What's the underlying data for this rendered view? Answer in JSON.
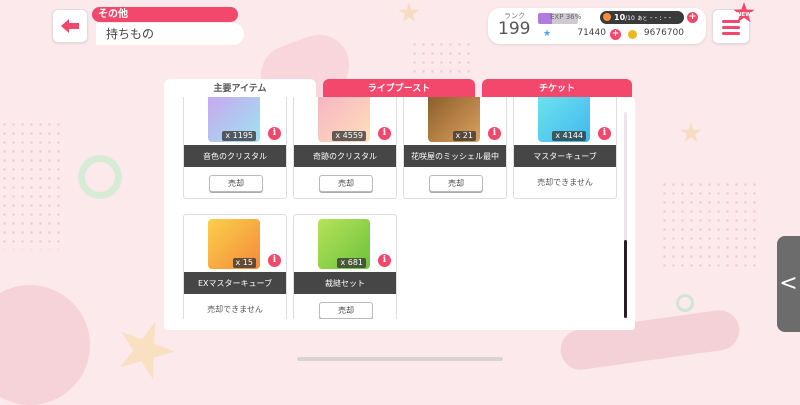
{
  "header": {
    "category": "その他",
    "title": "持ちもの"
  },
  "status": {
    "rank_label": "ランク",
    "rank": "199",
    "exp_label": "EXP",
    "exp_percent": "36",
    "exp_unit": "%",
    "exp_fraction": 0.36,
    "stamina": "10",
    "stamina_max": "/10",
    "stamina_suffix": "あと",
    "stamina_timer": "- - : - -",
    "stars": "71440",
    "coins": "9676700"
  },
  "menu": {
    "new_badge": "NEW"
  },
  "tabs": [
    {
      "label": "主要アイテム",
      "active": true
    },
    {
      "label": "ライブブースト",
      "active": false
    },
    {
      "label": "チケット",
      "active": false
    }
  ],
  "items": [
    {
      "name": "音色のクリスタル",
      "qty": "x 1195",
      "action": "売却",
      "sellable": true
    },
    {
      "name": "奇跡のクリスタル",
      "qty": "x 4559",
      "action": "売却",
      "sellable": true
    },
    {
      "name": "花咲屋のミッシェル最中",
      "qty": "x 21",
      "action": "売却",
      "sellable": true
    },
    {
      "name": "マスターキューブ",
      "qty": "x 4144",
      "action": "売却できません",
      "sellable": false
    },
    {
      "name": "EXマスターキューブ",
      "qty": "x 15",
      "action": "売却できません",
      "sellable": false
    },
    {
      "name": "裁縫セット",
      "qty": "x 681",
      "action": "売却",
      "sellable": true
    }
  ],
  "side_handle": "<",
  "colors": {
    "accent": "#f3476b",
    "background": "#fbe9ec"
  },
  "icons": [
    "back-arrow-icon",
    "menu-icon",
    "info-icon",
    "star-icon",
    "coin-icon",
    "stamina-icon"
  ]
}
